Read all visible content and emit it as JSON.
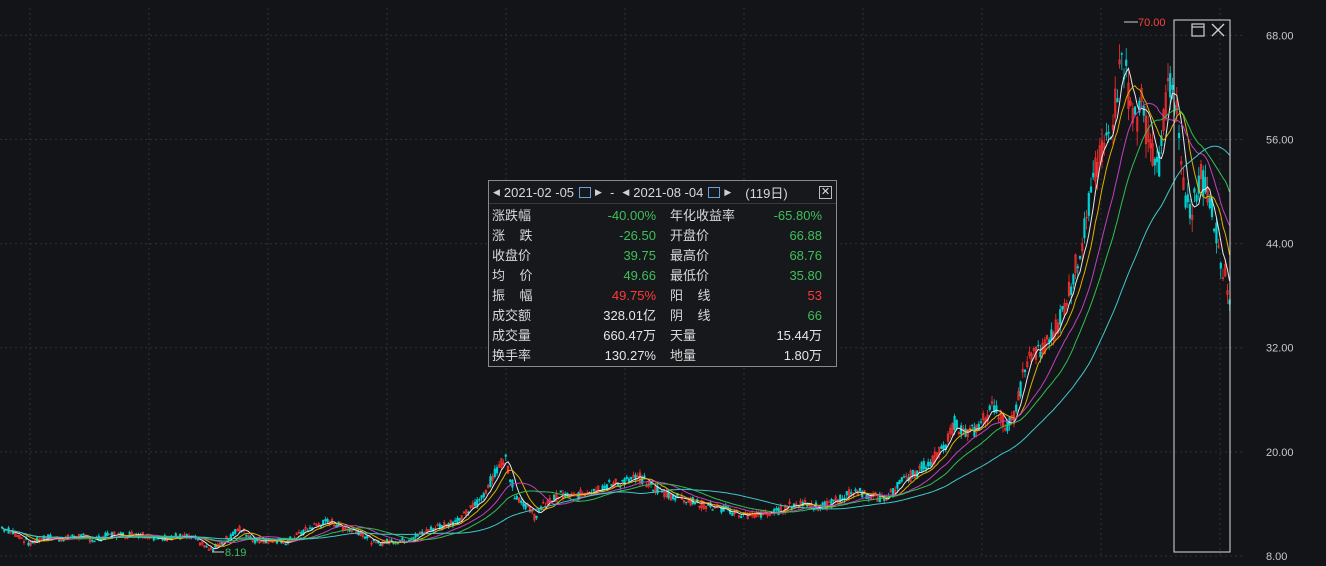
{
  "chart_data": {
    "type": "candlestick",
    "y_ticks": [
      "68.00",
      "56.00",
      "44.00",
      "32.00",
      "20.00",
      "8.00"
    ],
    "ylim": [
      8,
      70
    ],
    "max_marker": "70.00",
    "min_marker": "8.19",
    "close_series": [
      [
        0,
        11.4
      ],
      [
        15,
        10.6
      ],
      [
        30,
        9.4
      ],
      [
        45,
        10.2
      ],
      [
        60,
        10.0
      ],
      [
        80,
        10.3
      ],
      [
        95,
        9.8
      ],
      [
        110,
        10.5
      ],
      [
        125,
        10.4
      ],
      [
        140,
        10.6
      ],
      [
        160,
        10.0
      ],
      [
        175,
        10.3
      ],
      [
        195,
        10.0
      ],
      [
        210,
        8.6
      ],
      [
        225,
        9.8
      ],
      [
        240,
        11.2
      ],
      [
        255,
        9.8
      ],
      [
        270,
        9.8
      ],
      [
        285,
        9.5
      ],
      [
        300,
        10.6
      ],
      [
        315,
        11.5
      ],
      [
        330,
        12.0
      ],
      [
        345,
        11.2
      ],
      [
        360,
        10.8
      ],
      [
        375,
        9.4
      ],
      [
        390,
        9.7
      ],
      [
        405,
        9.8
      ],
      [
        420,
        10.5
      ],
      [
        440,
        11.5
      ],
      [
        460,
        12.2
      ],
      [
        480,
        14.5
      ],
      [
        495,
        17.5
      ],
      [
        505,
        19.5
      ],
      [
        515,
        15.0
      ],
      [
        525,
        14.0
      ],
      [
        535,
        12.5
      ],
      [
        545,
        14.0
      ],
      [
        560,
        15.0
      ],
      [
        575,
        14.8
      ],
      [
        590,
        15.6
      ],
      [
        610,
        16.2
      ],
      [
        625,
        16.6
      ],
      [
        640,
        17.0
      ],
      [
        655,
        15.8
      ],
      [
        670,
        15.0
      ],
      [
        685,
        14.6
      ],
      [
        700,
        14.0
      ],
      [
        715,
        13.6
      ],
      [
        730,
        13.2
      ],
      [
        745,
        12.6
      ],
      [
        760,
        12.8
      ],
      [
        775,
        13.0
      ],
      [
        790,
        13.8
      ],
      [
        805,
        14.2
      ],
      [
        820,
        13.5
      ],
      [
        840,
        14.6
      ],
      [
        855,
        15.5
      ],
      [
        870,
        15.0
      ],
      [
        885,
        14.5
      ],
      [
        900,
        16.4
      ],
      [
        915,
        17.5
      ],
      [
        930,
        19.0
      ],
      [
        945,
        20.4
      ],
      [
        955,
        23.5
      ],
      [
        965,
        22.0
      ],
      [
        975,
        22.5
      ],
      [
        985,
        24.0
      ],
      [
        995,
        25.5
      ],
      [
        1005,
        23.0
      ],
      [
        1015,
        24.0
      ],
      [
        1025,
        30.0
      ],
      [
        1035,
        31.5
      ],
      [
        1045,
        32.0
      ],
      [
        1055,
        34.0
      ],
      [
        1065,
        37.0
      ],
      [
        1075,
        41.0
      ],
      [
        1085,
        46.0
      ],
      [
        1095,
        52.0
      ],
      [
        1105,
        55.0
      ],
      [
        1115,
        60.0
      ],
      [
        1122,
        66.0
      ],
      [
        1128,
        62.0
      ],
      [
        1135,
        58.0
      ],
      [
        1142,
        60.0
      ],
      [
        1150,
        55.0
      ],
      [
        1158,
        52.0
      ],
      [
        1165,
        60.0
      ],
      [
        1172,
        64.0
      ],
      [
        1178,
        57.0
      ],
      [
        1185,
        48.0
      ],
      [
        1192,
        48.0
      ],
      [
        1200,
        52.0
      ],
      [
        1208,
        50.0
      ],
      [
        1215,
        46.0
      ],
      [
        1222,
        42.0
      ],
      [
        1230,
        37.5
      ]
    ],
    "ma_series": [
      {
        "name": "",
        "color": "#e8e8e8",
        "window": 5
      },
      {
        "name": "",
        "color": "#e0b000",
        "window": 10
      },
      {
        "name": "",
        "color": "#c040c0",
        "window": 20
      },
      {
        "name": "",
        "color": "#30c050",
        "window": 30
      },
      {
        "name": "",
        "color": "#40c8c8",
        "window": 60
      }
    ],
    "selected_range": {
      "x_start": 1174,
      "x_end": 1230
    }
  },
  "stats_panel": {
    "date_start": "2021-02 -05",
    "dash": "-",
    "date_end": "2021-08 -04",
    "days": "(119日)",
    "rows": [
      {
        "l1": "涨跌幅",
        "v1": "-40.00%",
        "c1": "g",
        "l2": "年化收益率",
        "v2": "-65.80%",
        "c2": "g"
      },
      {
        "l1": "涨    跌",
        "v1": "-26.50",
        "c1": "g",
        "l2": "开盘价",
        "v2": "66.88",
        "c2": "g"
      },
      {
        "l1": "收盘价",
        "v1": "39.75",
        "c1": "g",
        "l2": "最高价",
        "v2": "68.76",
        "c2": "g"
      },
      {
        "l1": "均    价",
        "v1": "49.66",
        "c1": "g",
        "l2": "最低价",
        "v2": "35.80",
        "c2": "g"
      },
      {
        "l1": "振    幅",
        "v1": "49.75%",
        "c1": "r",
        "l2": "阳    线",
        "v2": "53",
        "c2": "r"
      },
      {
        "l1": "成交额",
        "v1": "328.01亿",
        "c1": "w",
        "l2": "阴    线",
        "v2": "66",
        "c2": "g"
      },
      {
        "l1": "成交量",
        "v1": "660.47万",
        "c1": "w",
        "l2": "天量",
        "v2": "15.44万",
        "c2": "w"
      },
      {
        "l1": "换手率",
        "v1": "130.27%",
        "c1": "w",
        "l2": "地量",
        "v2": "1.80万",
        "c2": "w"
      }
    ]
  },
  "colors": {
    "up": "#ff3030",
    "down": "#00d0d0",
    "grid": "#2e3138",
    "marker_max": "#ff4040",
    "marker_min": "#3fbf5a"
  }
}
